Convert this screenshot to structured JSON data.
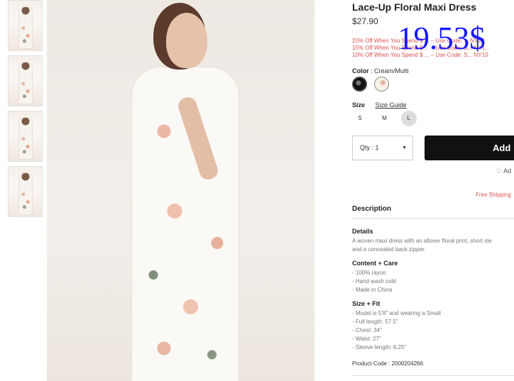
{
  "product": {
    "title": "Lace-Up Floral Maxi Dress",
    "price": "$27.90",
    "overlay_price": "19.53$",
    "promos": [
      "20% Off When You Spend $ ... – Use Code: ... NY20",
      "15% Off When You Spend $ ... – Use Code: S... NY1...",
      "10% Off When You Spend $ ... – Use Code: S... NY10"
    ]
  },
  "color": {
    "label": "Color",
    "value": ": Cream/Multi"
  },
  "size": {
    "label": "Size",
    "guide": "Size Guide",
    "options": [
      "S",
      "M",
      "L"
    ]
  },
  "qty": {
    "label": "Qty : 1",
    "caret": "▼"
  },
  "cart": {
    "add_label": "Add"
  },
  "wishlist": {
    "label": "Ad"
  },
  "shipping": {
    "label": "Free Shipping"
  },
  "description": {
    "heading": "Description",
    "details_heading": "Details",
    "details_text": [
      "A woven maxi dress with an allover floral print, short sle",
      "and a concealed back zipper."
    ],
    "content_heading": "Content + Care",
    "content_list": [
      "- 100% rayon",
      "- Hand wash cold",
      "- Made in China"
    ],
    "fit_heading": "Size + Fit",
    "fit_list": [
      "- Model is 5'8\" and wearing a Small",
      "- Full length: 57.5\"",
      "- Chest: 34\"",
      "- Waist: 27\"",
      "- Sleeve length: 6.25\""
    ],
    "product_code": "Product Code : 2000204266"
  }
}
